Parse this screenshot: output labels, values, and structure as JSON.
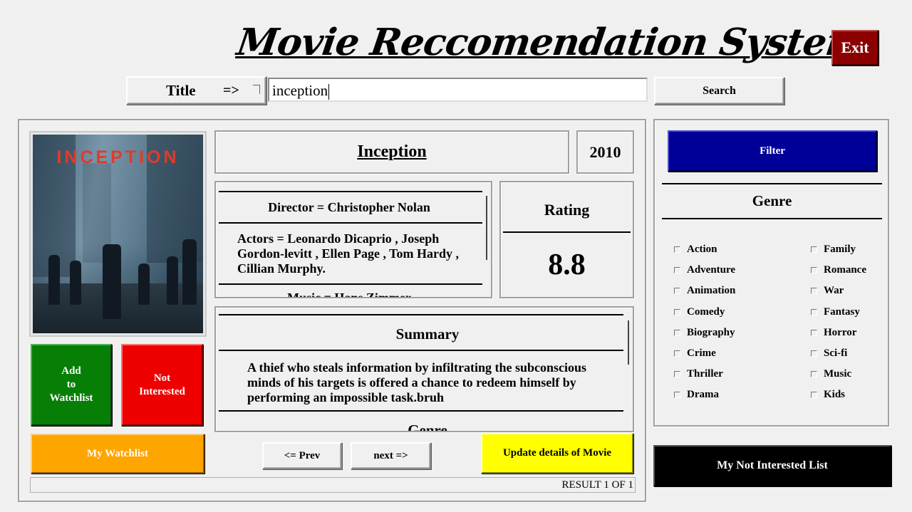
{
  "app": {
    "title": "Movie Reccomendation System",
    "exit_label": "Exit"
  },
  "search": {
    "by_label": "Title",
    "arrow": "=>",
    "query": "inception",
    "button_label": "Search"
  },
  "movie": {
    "poster_text": "INCEPTION",
    "title": "Inception",
    "year": "2010",
    "director": "Director = Christopher Nolan",
    "actors": "Actors = Leonardo Dicaprio , Joseph Gordon-levitt , Ellen Page , Tom Hardy , Cillian Murphy.",
    "music": "Music = Hans Zimmer",
    "rating_label": "Rating",
    "rating": "8.8",
    "summary_label": "Summary",
    "summary": "A thief who steals information by infiltrating the subconscious minds of his targets is offered a chance to redeem himself by performing an impossible task.bruh",
    "genre_label": "Genre"
  },
  "actions": {
    "add_watchlist": "Add\nto\nWatchlist",
    "not_interested": "Not\nInterested",
    "my_watchlist": "My Watchlist",
    "prev": "<= Prev",
    "next": "next =>",
    "update": "Update details of Movie"
  },
  "status": "RESULT 1 OF 1",
  "filter": {
    "button_label": "Filter",
    "genre_header": "Genre",
    "genres_left": [
      "Action",
      "Adventure",
      "Animation",
      "Comedy",
      "Biography",
      "Crime",
      "Thriller",
      "Drama"
    ],
    "genres_right": [
      "Family",
      "Romance",
      "War",
      "Fantasy",
      "Horror",
      "Sci-fi",
      "Music",
      "Kids"
    ]
  },
  "not_interested_list_label": "My Not Interested List",
  "colors": {
    "exit": "#8b0000",
    "add_watchlist": "#077f07",
    "not_interested": "#ee0000",
    "my_watchlist": "#ffa500",
    "update": "#ffff00",
    "filter": "#000099",
    "not_interested_list": "#000000"
  }
}
